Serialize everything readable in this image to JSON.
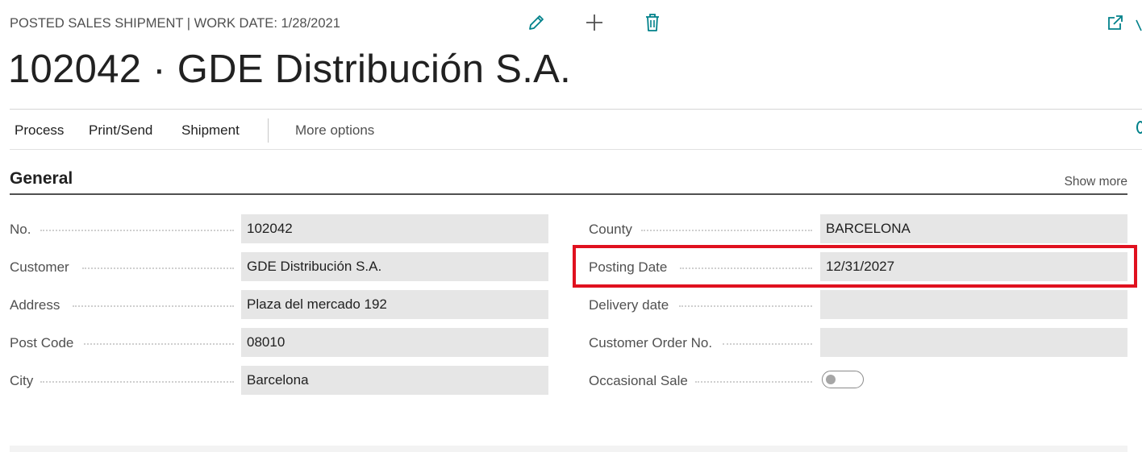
{
  "header": {
    "breadcrumb": "POSTED SALES SHIPMENT | WORK DATE: 1/28/2021",
    "title": "102042 · GDE Distribución S.A.",
    "icons": [
      "pencil-icon",
      "plus-icon",
      "trash-icon",
      "open-in-new-window-icon"
    ]
  },
  "actions": {
    "items": [
      "Process",
      "Print/Send",
      "Shipment"
    ],
    "more": "More options"
  },
  "section": {
    "title": "General",
    "show_more": "Show more"
  },
  "fields_left": [
    {
      "label": "No.",
      "value": "102042"
    },
    {
      "label": "Customer",
      "value": "GDE Distribución S.A."
    },
    {
      "label": "Address",
      "value": "Plaza del mercado 192"
    },
    {
      "label": "Post Code",
      "value": "08010"
    },
    {
      "label": "City",
      "value": "Barcelona"
    }
  ],
  "fields_right": [
    {
      "label": "County",
      "value": "BARCELONA"
    },
    {
      "label": "Posting Date",
      "value": "12/31/2027"
    },
    {
      "label": "Delivery date",
      "value": ""
    },
    {
      "label": "Customer Order No.",
      "value": ""
    },
    {
      "label": "Occasional Sale",
      "toggle": false
    }
  ],
  "highlighted_field": "Posting Date",
  "colors": {
    "accent": "#00818a",
    "highlight": "#e0111f",
    "field_bg": "#e6e6e6"
  }
}
